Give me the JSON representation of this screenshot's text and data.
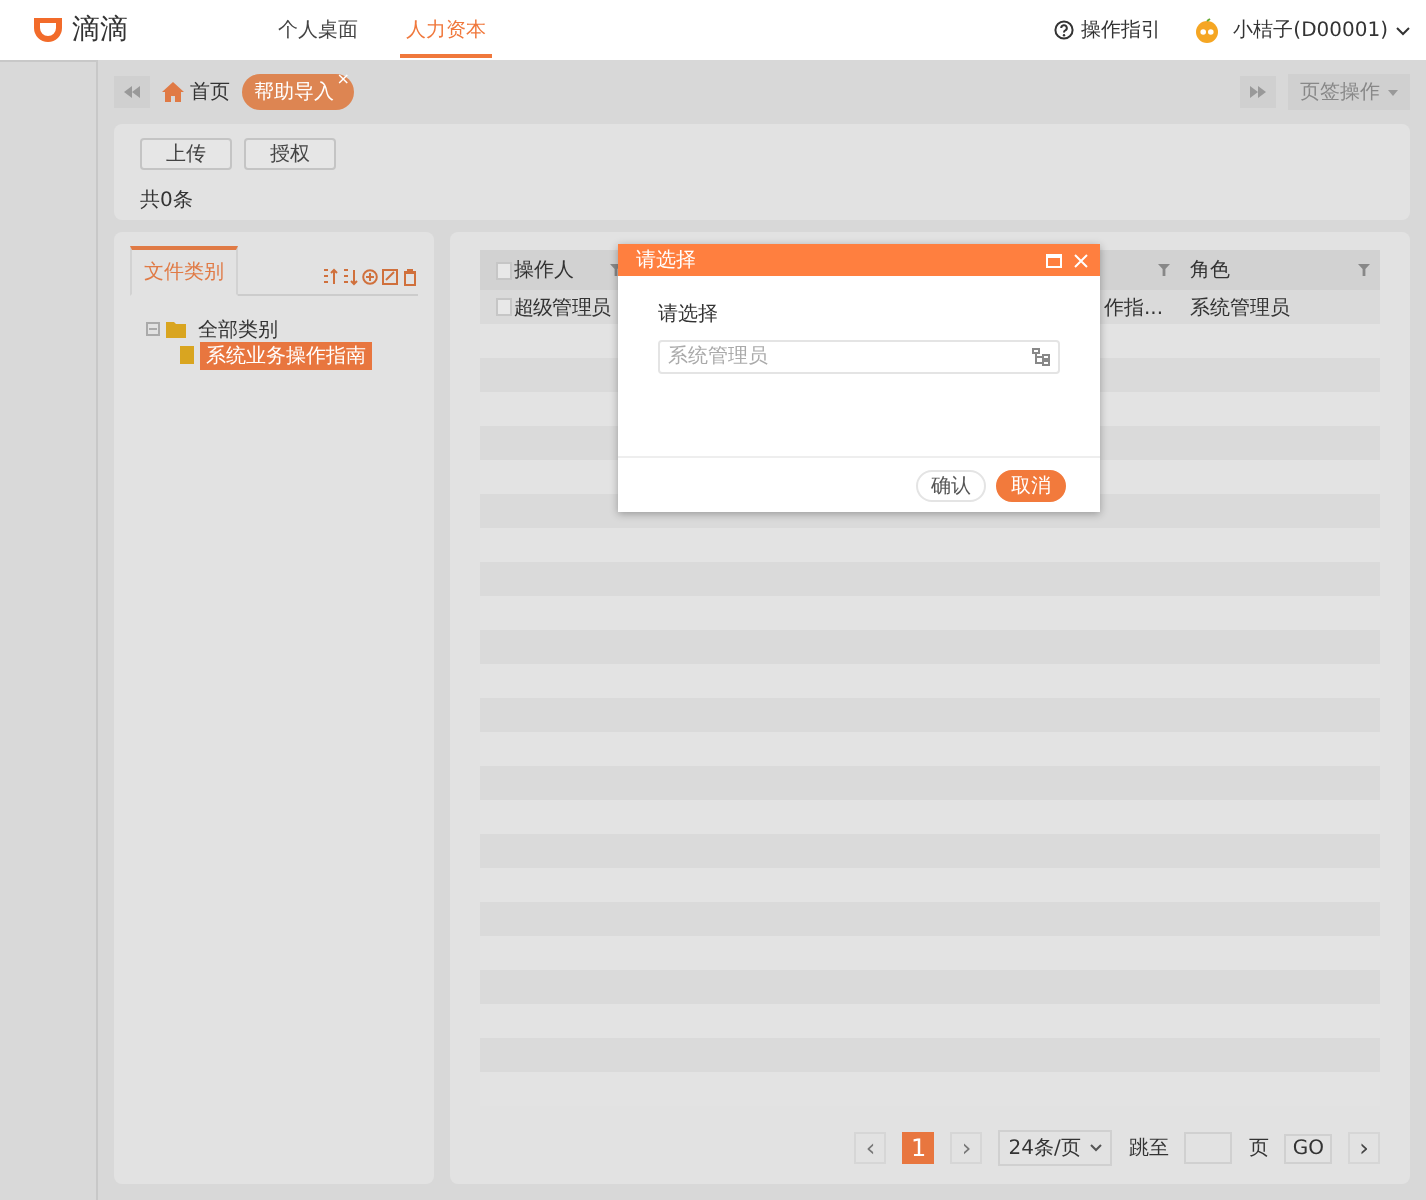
{
  "header": {
    "logo_text": "滴滴",
    "nav": [
      {
        "label": "个人桌面",
        "selected": false
      },
      {
        "label": "人力资本",
        "selected": true
      }
    ],
    "help": "操作指引",
    "user": "小桔子(D00001)"
  },
  "tab_bar": {
    "home": "首页",
    "tabs": [
      {
        "label": "帮助导入",
        "selected": true,
        "close": "×"
      }
    ],
    "menu": "页签操作"
  },
  "toolbar": {
    "buttons": [
      "上传",
      "授权"
    ],
    "count": "共0条"
  },
  "category_panel": {
    "tab": "文件类别",
    "tree": [
      {
        "label": "全部类别",
        "expanded": true,
        "selected": false,
        "children": [
          {
            "label": "系统业务操作指南",
            "selected": true
          }
        ]
      }
    ]
  },
  "table": {
    "all_checked": false,
    "columns": [
      "操作人",
      "角色"
    ],
    "rows": [
      {
        "checked": false,
        "operator": "超级管理员",
        "column_3": "作指...",
        "role": "系统管理员"
      }
    ]
  },
  "pager": {
    "prev": "‹",
    "pages": [
      {
        "label": "1",
        "selected": true
      }
    ],
    "next": "›",
    "page_size": "24条/页",
    "jump_label": "跳至",
    "page_unit": "页",
    "go": "GO",
    "last": "›"
  },
  "dialog": {
    "title": "请选择",
    "label": "请选择",
    "placeholder": "系统管理员",
    "buttons": [
      {
        "label": "确认",
        "kind": "secondary"
      },
      {
        "label": "取消",
        "kind": "primary"
      }
    ]
  }
}
